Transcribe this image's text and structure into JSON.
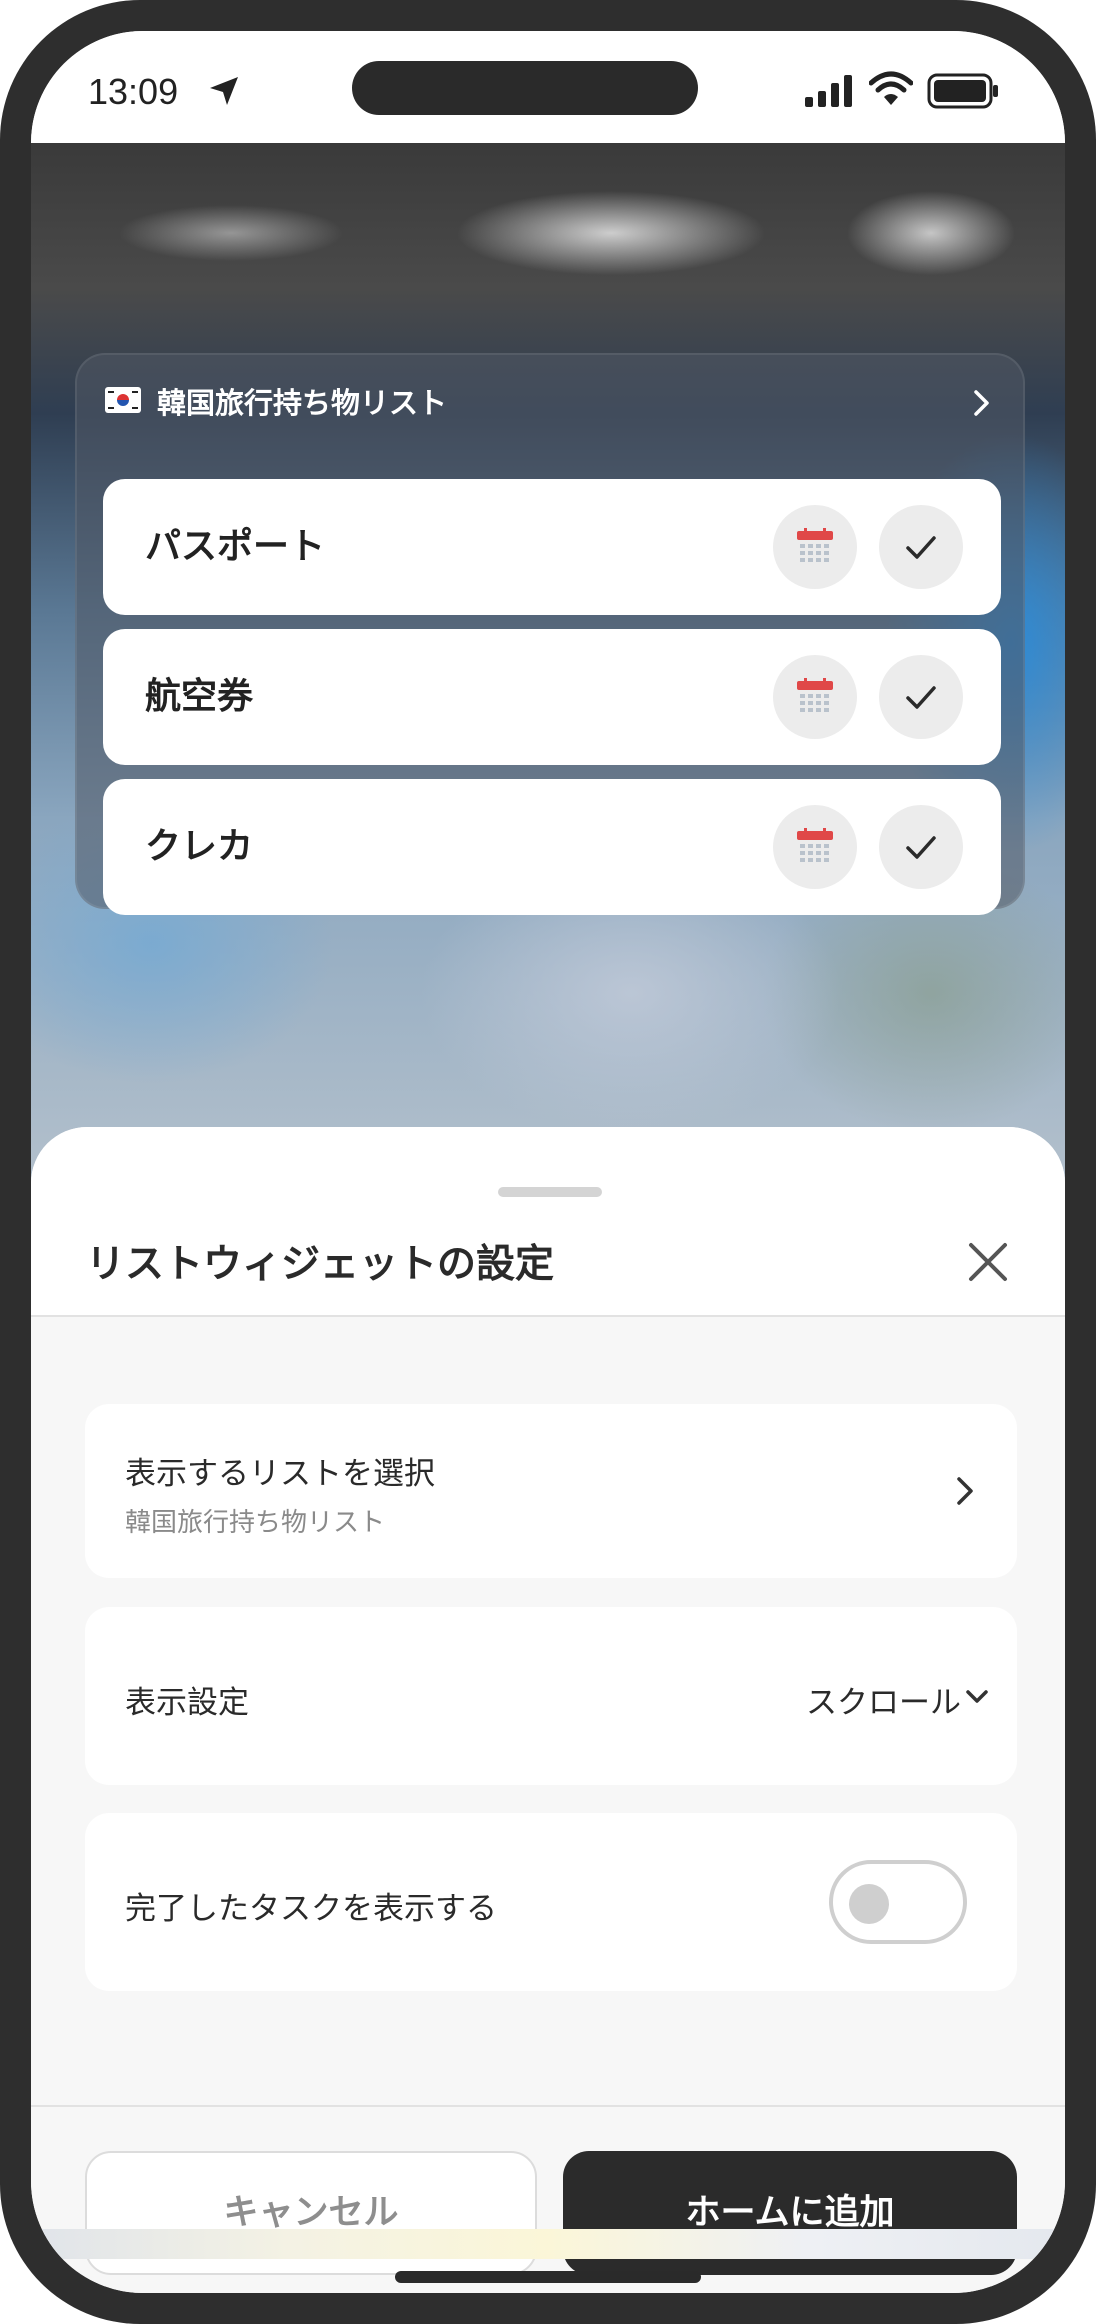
{
  "status_bar": {
    "time": "13:09",
    "icons": [
      "location-arrow-icon",
      "signal-icon",
      "wifi-icon",
      "battery-icon"
    ]
  },
  "widget": {
    "flag_icon": "korea-flag-icon",
    "title": "韓国旅行持ち物リスト",
    "items": [
      {
        "label": "パスポート",
        "icons": [
          "calendar-icon",
          "check-icon"
        ]
      },
      {
        "label": "航空券",
        "icons": [
          "calendar-icon",
          "check-icon"
        ]
      },
      {
        "label": "クレカ",
        "icons": [
          "calendar-icon",
          "check-icon"
        ]
      }
    ]
  },
  "sheet": {
    "title": "リストウィジェットの設定",
    "select_list": {
      "label": "表示するリストを選択",
      "value": "韓国旅行持ち物リスト"
    },
    "display_setting": {
      "label": "表示設定",
      "value": "スクロール"
    },
    "show_completed": {
      "label": "完了したタスクを表示する",
      "enabled": false
    },
    "cancel_label": "キャンセル",
    "add_label": "ホームに追加"
  },
  "colors": {
    "primary_button": "#2b2b2b",
    "calendar_red": "#e04848",
    "toggle_off": "#cfcfcf"
  }
}
